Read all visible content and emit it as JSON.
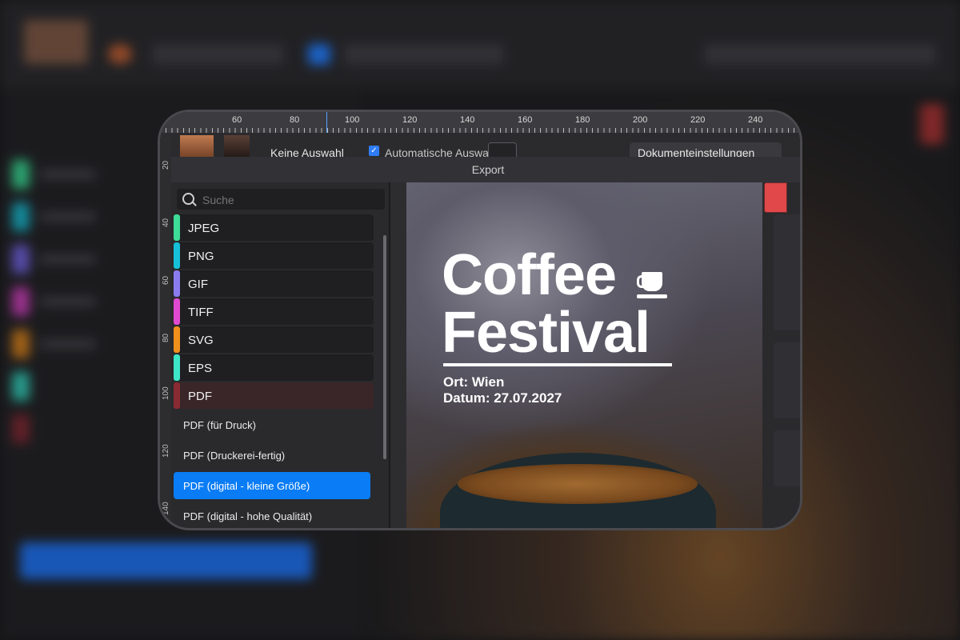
{
  "ruler": {
    "labels": [
      "60",
      "80",
      "100",
      "120",
      "140",
      "160",
      "180",
      "200",
      "220",
      "240"
    ]
  },
  "left_ruler": {
    "labels": [
      "20",
      "40",
      "60",
      "80",
      "100",
      "120",
      "140"
    ]
  },
  "toolbar": {
    "selection_label": "Keine Auswahl",
    "auto_select_label": "Automatische Auswahl:",
    "auto_select_checked": true,
    "doc_settings_label": "Dokumenteinstellungen"
  },
  "dialog": {
    "title": "Export",
    "search_placeholder": "Suche",
    "formats": [
      {
        "label": "JPEG",
        "color": "#3ddc97"
      },
      {
        "label": "PNG",
        "color": "#16c0d8"
      },
      {
        "label": "GIF",
        "color": "#8a7cf0"
      },
      {
        "label": "TIFF",
        "color": "#e04ad0"
      },
      {
        "label": "SVG",
        "color": "#f0901c"
      },
      {
        "label": "EPS",
        "color": "#3ee6c8"
      },
      {
        "label": "PDF",
        "color": "#8a2a32"
      }
    ],
    "presets": [
      {
        "label": "PDF (für Druck)",
        "selected": false
      },
      {
        "label": "PDF (Druckerei-fertig)",
        "selected": false
      },
      {
        "label": "PDF (digital - kleine Größe)",
        "selected": true
      },
      {
        "label": "PDF (digital - hohe Qualität)",
        "selected": false
      }
    ]
  },
  "poster": {
    "title_line1": "Coffee",
    "title_line2": "Festival",
    "location": "Ort: Wien",
    "date": "Datum: 27.07.2027"
  },
  "colors": {
    "accent": "#0a7cf5",
    "dialog_bg": "#2a2a2d"
  }
}
